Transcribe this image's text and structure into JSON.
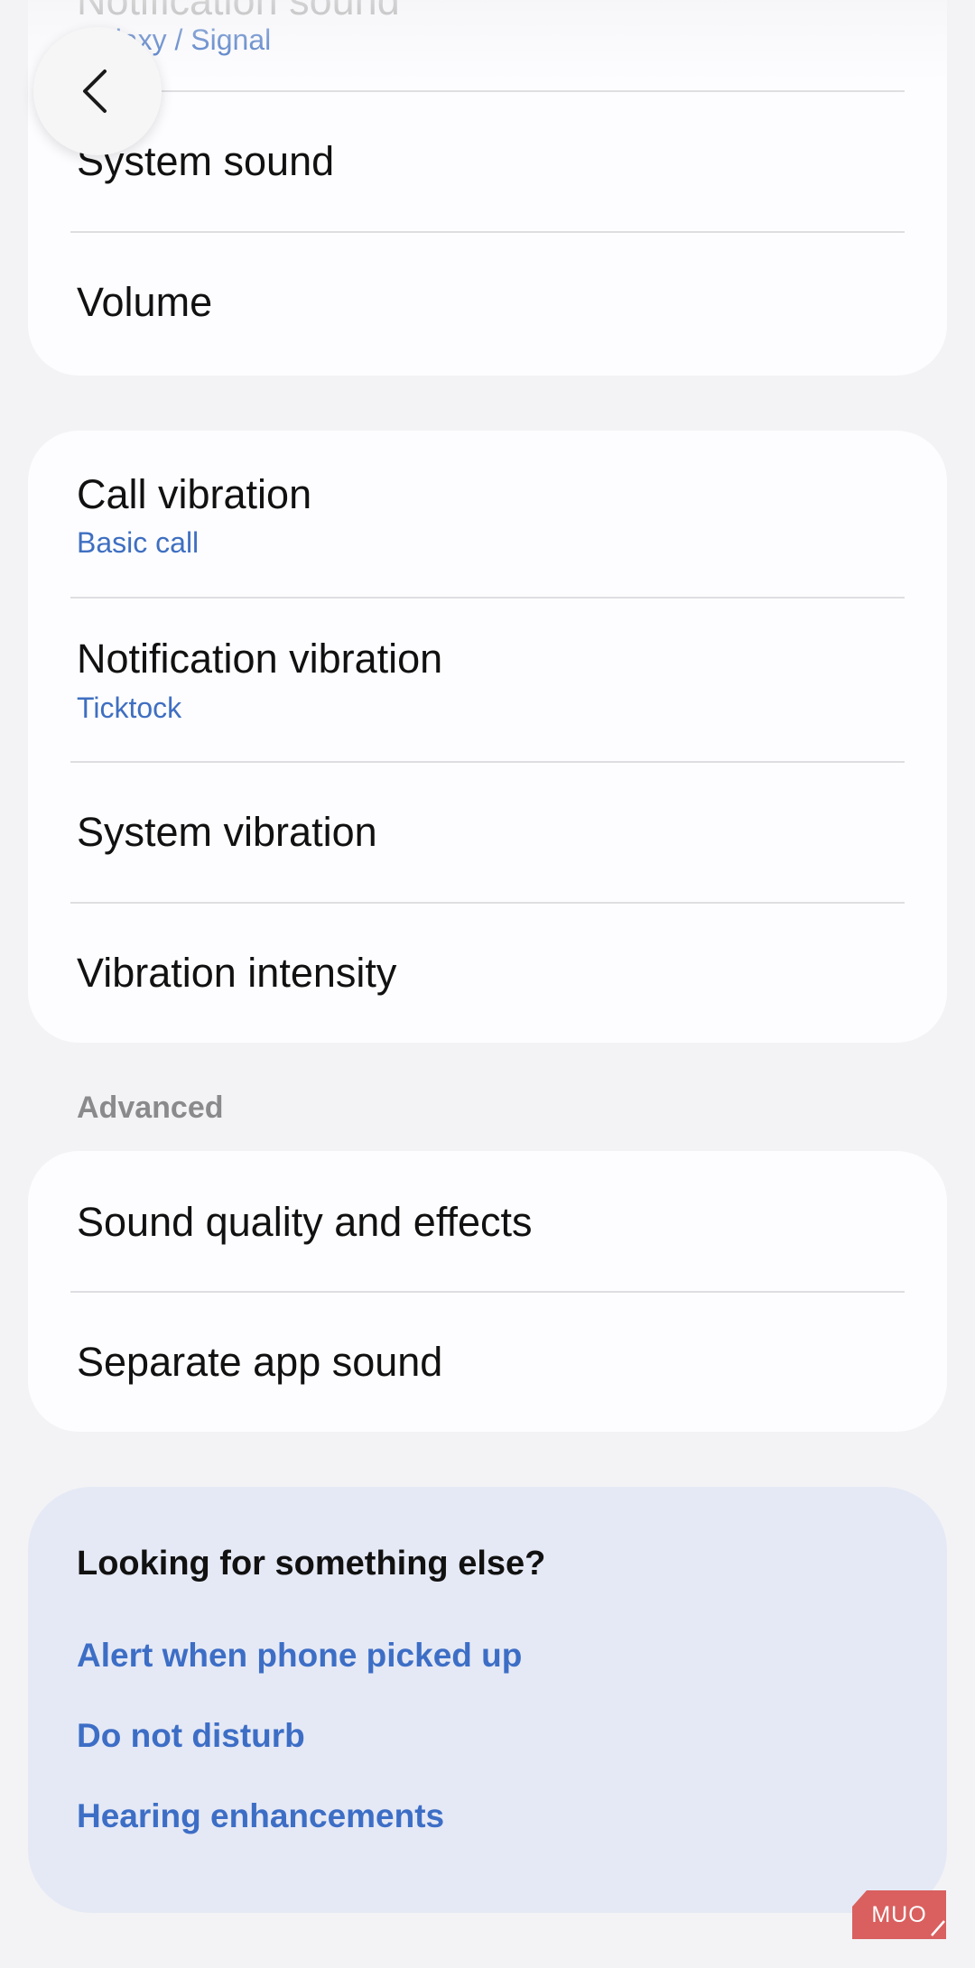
{
  "top_card": {
    "notification_sound": {
      "label": "Notification sound",
      "value": "Galaxy / Signal"
    },
    "items": [
      {
        "label": "System sound"
      },
      {
        "label": "Volume"
      }
    ]
  },
  "vibration_card": {
    "items": [
      {
        "label": "Call vibration",
        "value": "Basic call"
      },
      {
        "label": "Notification vibration",
        "value": "Ticktock"
      },
      {
        "label": "System vibration"
      },
      {
        "label": "Vibration intensity"
      }
    ]
  },
  "advanced": {
    "header": "Advanced",
    "items": [
      {
        "label": "Sound quality and effects"
      },
      {
        "label": "Separate app sound"
      }
    ]
  },
  "suggestions": {
    "title": "Looking for something else?",
    "links": [
      {
        "label": "Alert when phone picked up"
      },
      {
        "label": "Do not disturb"
      },
      {
        "label": "Hearing enhancements"
      }
    ]
  },
  "watermark": {
    "text": "MUO"
  },
  "icons": {
    "back": "chevron-left-icon"
  },
  "colors": {
    "background": "#f3f3f5",
    "card": "#fdfdff",
    "accent": "#3d6ec6",
    "suggest_card": "#e5e9f5",
    "watermark": "#d9605f"
  }
}
